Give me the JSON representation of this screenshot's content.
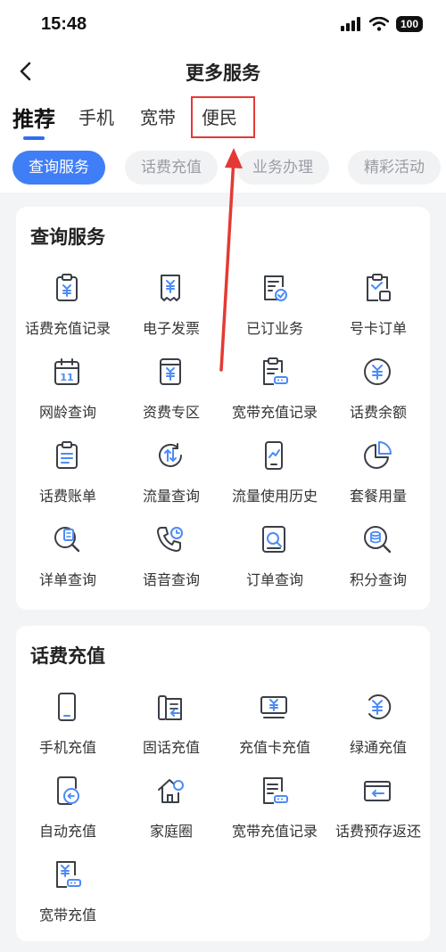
{
  "status_bar": {
    "time": "15:48",
    "battery": "100"
  },
  "navbar": {
    "title": "更多服务"
  },
  "tabs": [
    {
      "label": "推荐",
      "active": true
    },
    {
      "label": "手机",
      "active": false
    },
    {
      "label": "宽带",
      "active": false
    },
    {
      "label": "便民",
      "active": false
    }
  ],
  "chips": [
    {
      "label": "查询服务",
      "active": true
    },
    {
      "label": "话费充值",
      "active": false
    },
    {
      "label": "业务办理",
      "active": false
    },
    {
      "label": "精彩活动",
      "active": false
    }
  ],
  "query_section": {
    "title": "查询服务",
    "items": [
      {
        "label": "话费充值记录",
        "icon": "clipboard-yuan-icon"
      },
      {
        "label": "电子发票",
        "icon": "receipt-yuan-icon"
      },
      {
        "label": "已订业务",
        "icon": "document-check-icon"
      },
      {
        "label": "号卡订单",
        "icon": "clipboard-sim-icon"
      },
      {
        "label": "网龄查询",
        "icon": "calendar-icon"
      },
      {
        "label": "资费专区",
        "icon": "book-yuan-icon"
      },
      {
        "label": "宽带充值记录",
        "icon": "clipboard-router-icon"
      },
      {
        "label": "话费余额",
        "icon": "coin-yuan-icon"
      },
      {
        "label": "话费账单",
        "icon": "bill-list-icon"
      },
      {
        "label": "流量查询",
        "icon": "data-transfer-icon"
      },
      {
        "label": "流量使用历史",
        "icon": "phone-chart-icon"
      },
      {
        "label": "套餐用量",
        "icon": "pie-chart-icon"
      },
      {
        "label": "详单查询",
        "icon": "search-document-icon"
      },
      {
        "label": "语音查询",
        "icon": "phone-clock-icon"
      },
      {
        "label": "订单查询",
        "icon": "order-search-icon"
      },
      {
        "label": "积分查询",
        "icon": "points-search-icon"
      }
    ]
  },
  "recharge_section": {
    "title": "话费充值",
    "items": [
      {
        "label": "手机充值",
        "icon": "mobile-phone-icon"
      },
      {
        "label": "固话充值",
        "icon": "landline-icon"
      },
      {
        "label": "充值卡充值",
        "icon": "recharge-card-icon"
      },
      {
        "label": "绿通充值",
        "icon": "green-channel-icon"
      },
      {
        "label": "自动充值",
        "icon": "auto-recharge-icon"
      },
      {
        "label": "家庭圈",
        "icon": "home-circle-icon"
      },
      {
        "label": "宽带充值记录",
        "icon": "broadband-record-icon"
      },
      {
        "label": "话费预存返还",
        "icon": "prepay-return-icon"
      },
      {
        "label": "宽带充值",
        "icon": "broadband-recharge-icon"
      }
    ]
  },
  "colors": {
    "accent": "#3f7ef7",
    "highlight": "#e53935",
    "icon_stroke": "#3a3f47",
    "icon_accent": "#4c8bf5"
  }
}
